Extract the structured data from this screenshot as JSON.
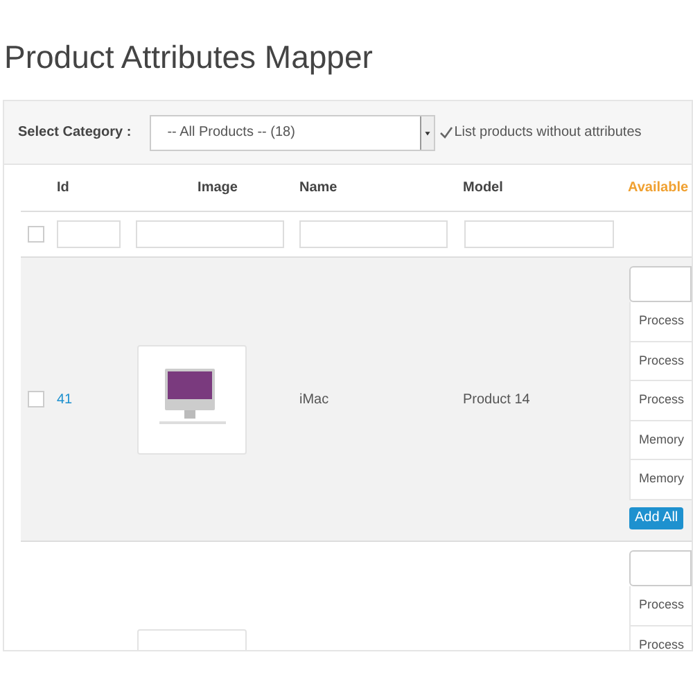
{
  "title": "Product Attributes Mapper",
  "filter": {
    "label": "Select Category :",
    "select_value": "-- All Products -- (18)",
    "option": {
      "label": "List products without attributes",
      "checked": true
    }
  },
  "table": {
    "columns": [
      "Id",
      "Image",
      "Name",
      "Model",
      "Available"
    ],
    "filter_row": {
      "checked": false
    },
    "rows": [
      {
        "checked": false,
        "id": "41",
        "name": "iMac",
        "model": "Product 14",
        "attributes": [
          "Process",
          "Process",
          "Process",
          "Memory",
          "Memory"
        ],
        "button": "Add All"
      },
      {
        "attributes": [
          "Process",
          "Process"
        ]
      }
    ]
  }
}
